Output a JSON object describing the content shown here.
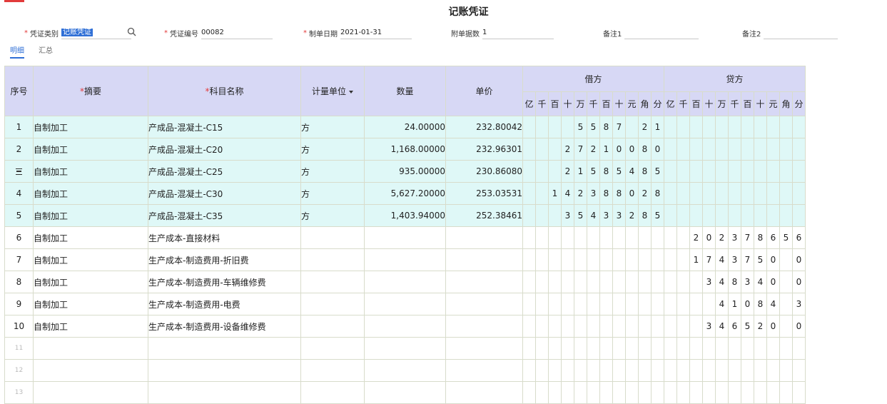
{
  "title": "记账凭证",
  "header": {
    "voucher_type_label": "凭证类别",
    "voucher_type_value": "记账凭证",
    "voucher_no_label": "凭证编号",
    "voucher_no_value": "00082",
    "date_label": "制单日期",
    "date_value": "2021-01-31",
    "attachments_label": "附单据数",
    "attachments_value": "1",
    "note1_label": "备注1",
    "note1_value": "",
    "note2_label": "备注2",
    "note2_value": ""
  },
  "tabs": [
    {
      "label": "明细",
      "active": true
    },
    {
      "label": "汇总",
      "active": false
    }
  ],
  "columns": {
    "seq": "序号",
    "summary": "摘要",
    "account": "科目名称",
    "unit": "计量单位",
    "qty": "数量",
    "price": "单价",
    "debit": "借方",
    "credit": "贷方"
  },
  "digit_headers": [
    "亿",
    "千",
    "百",
    "十",
    "万",
    "千",
    "百",
    "十",
    "元",
    "角",
    "分"
  ],
  "rows": [
    {
      "seq": "1",
      "summary": "自制加工",
      "account": "产成品-混凝土-C15",
      "unit": "方",
      "qty": "24.00000",
      "price": "232.80042",
      "debit": "5587 21",
      "credit": ""
    },
    {
      "seq": "2",
      "summary": "自制加工",
      "account": "产成品-混凝土-C20",
      "unit": "方",
      "qty": "1,168.00000",
      "price": "232.96301",
      "debit": "27210080",
      "credit": ""
    },
    {
      "seq": "",
      "summary": "自制加工",
      "account": "产成品-混凝土-C25",
      "unit": "方",
      "qty": "935.00000",
      "price": "230.86080",
      "debit": "21585485",
      "credit": ""
    },
    {
      "seq": "4",
      "summary": "自制加工",
      "account": "产成品-混凝土-C30",
      "unit": "方",
      "qty": "5,627.20000",
      "price": "253.03531",
      "debit": "142388028",
      "credit": ""
    },
    {
      "seq": "5",
      "summary": "自制加工",
      "account": "产成品-混凝土-C35",
      "unit": "方",
      "qty": "1,403.94000",
      "price": "252.38461",
      "debit": "35433285",
      "credit": ""
    },
    {
      "seq": "6",
      "summary": "自制加工",
      "account": "生产成本-直接材料",
      "unit": "",
      "qty": "",
      "price": "",
      "debit": "",
      "credit": "202378656"
    },
    {
      "seq": "7",
      "summary": "自制加工",
      "account": "生产成本-制造费用-折旧费",
      "unit": "",
      "qty": "",
      "price": "",
      "debit": "",
      "credit": "1743750 0"
    },
    {
      "seq": "8",
      "summary": "自制加工",
      "account": "生产成本-制造费用-车辆维修费",
      "unit": "",
      "qty": "",
      "price": "",
      "debit": "",
      "credit": "348340 0"
    },
    {
      "seq": "9",
      "summary": "自制加工",
      "account": "生产成本-制造费用-电费",
      "unit": "",
      "qty": "",
      "price": "",
      "debit": "",
      "credit": "41084 3"
    },
    {
      "seq": "10",
      "summary": "自制加工",
      "account": "生产成本-制造费用-设备维修费",
      "unit": "",
      "qty": "",
      "price": "",
      "debit": "",
      "credit": "346520 0"
    }
  ],
  "empty_rows": [
    "11",
    "12",
    "13"
  ],
  "colors": {
    "accent": "#2f6fd6",
    "required": "#e23b3b",
    "header_bg": "#d7d8f5",
    "row_bg": "#dff8f7"
  }
}
